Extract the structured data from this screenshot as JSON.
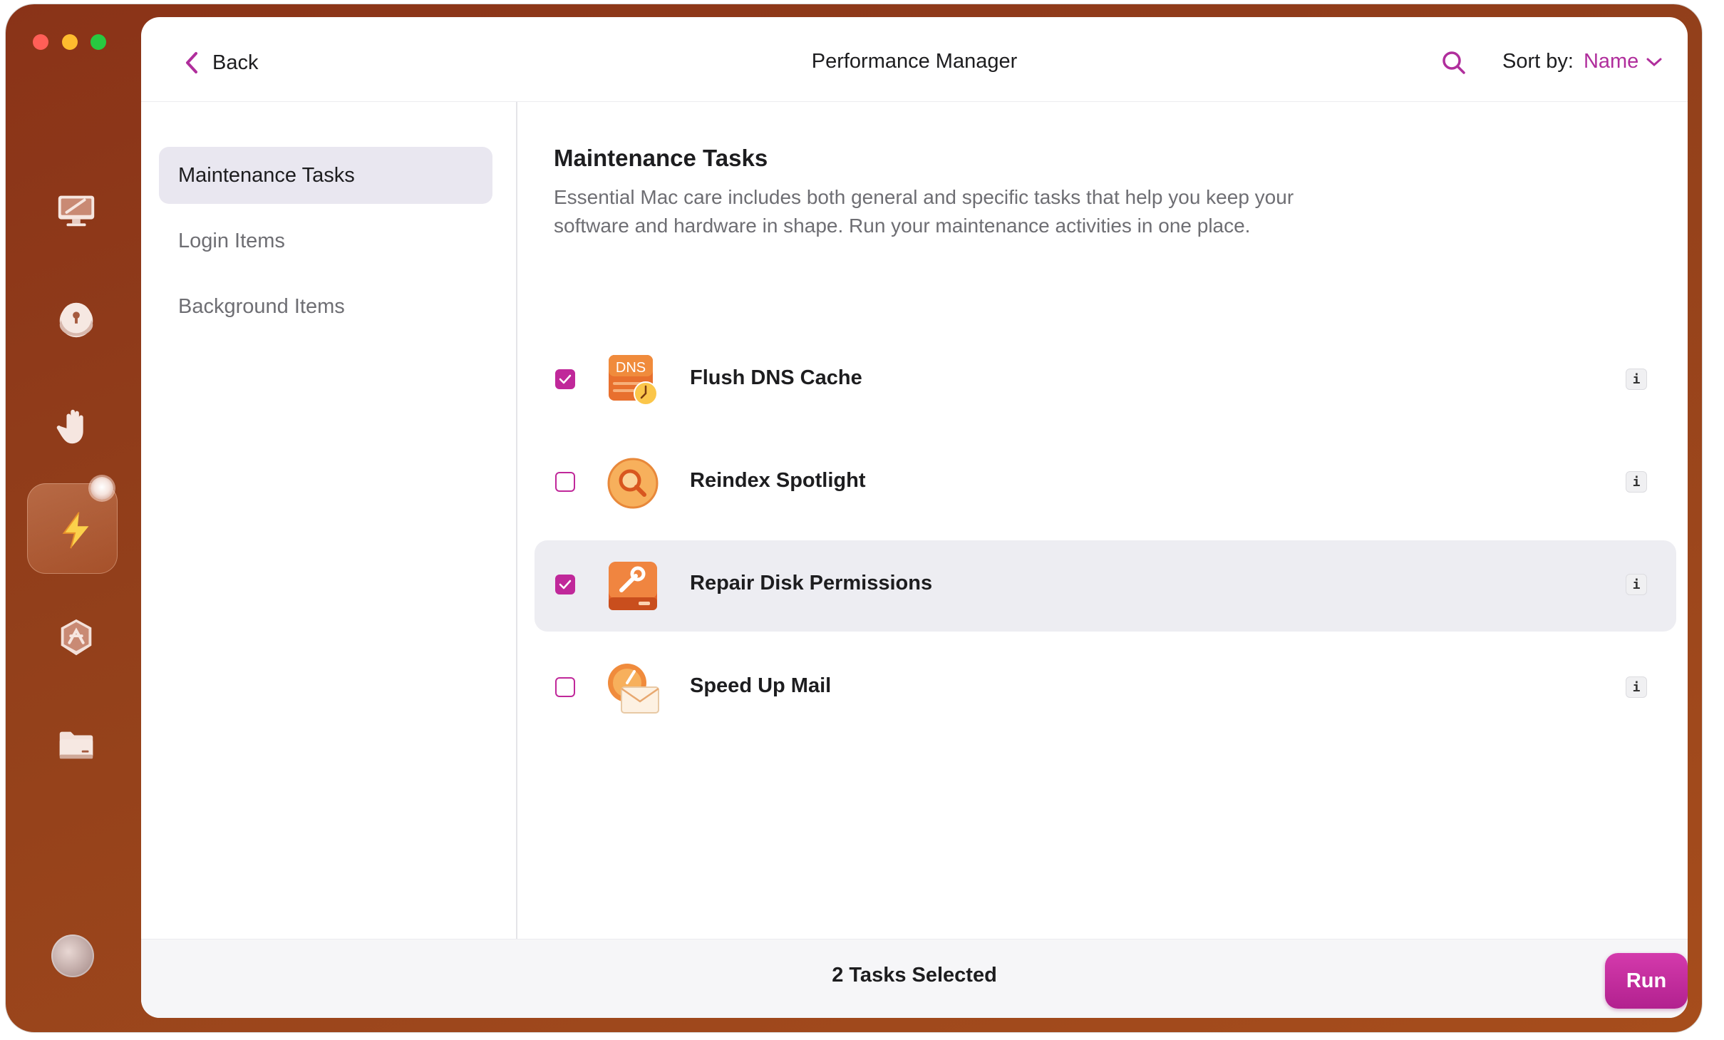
{
  "window": {
    "title": "Performance Manager",
    "back_label": "Back",
    "sort_label": "Sort by:",
    "sort_value": "Name"
  },
  "sidebar_icons": [
    "monitor-icon",
    "privacy-icon",
    "hand-protection-icon",
    "performance-lightning-icon",
    "applications-icon",
    "files-folder-icon",
    "profile-avatar-icon"
  ],
  "nav": {
    "items": [
      {
        "label": "Maintenance Tasks",
        "active": true
      },
      {
        "label": "Login Items",
        "active": false
      },
      {
        "label": "Background Items",
        "active": false
      }
    ]
  },
  "section": {
    "title": "Maintenance Tasks",
    "description": "Essential Mac care includes both general and specific tasks that help you keep your software and hardware in shape. Run your maintenance activities in one place."
  },
  "tasks": [
    {
      "label": "Flush DNS Cache",
      "checked": true,
      "icon": "dns-cache-icon",
      "icon_text": "DNS",
      "info": "i"
    },
    {
      "label": "Reindex Spotlight",
      "checked": false,
      "icon": "spotlight-magnifier-icon",
      "info": "i"
    },
    {
      "label": "Repair Disk Permissions",
      "checked": true,
      "icon": "disk-wrench-icon",
      "info": "i"
    },
    {
      "label": "Speed Up Mail",
      "checked": false,
      "icon": "mail-speed-icon",
      "info": "i"
    }
  ],
  "footer": {
    "status": "2 Tasks Selected",
    "run_label": "Run"
  },
  "colors": {
    "accent": "#b02e9c",
    "checkbox": "#c0289a",
    "sidebar_bg": "#93401b"
  }
}
